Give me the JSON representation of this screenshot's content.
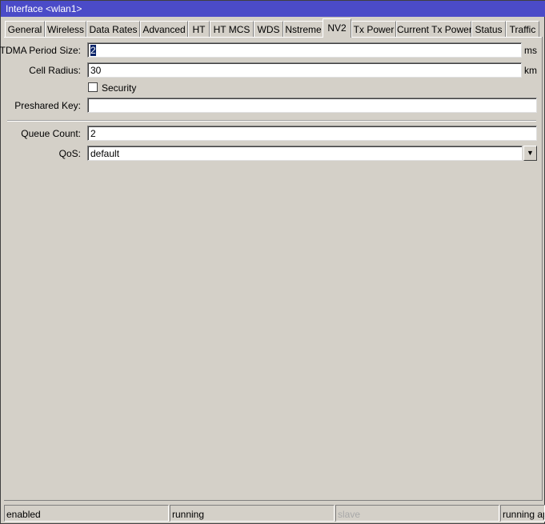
{
  "window": {
    "title": "Interface <wlan1>"
  },
  "tabs": [
    {
      "label": "General"
    },
    {
      "label": "Wireless"
    },
    {
      "label": "Data Rates"
    },
    {
      "label": "Advanced"
    },
    {
      "label": "HT"
    },
    {
      "label": "HT MCS"
    },
    {
      "label": "WDS"
    },
    {
      "label": "Nstreme"
    },
    {
      "label": "NV2",
      "selected": true
    },
    {
      "label": "Tx Power"
    },
    {
      "label": "Current Tx Power"
    },
    {
      "label": "Status"
    },
    {
      "label": "Traffic"
    }
  ],
  "form": {
    "tdma_label": "TDMA Period Size:",
    "tdma_value": "2",
    "tdma_unit": "ms",
    "cell_label": "Cell Radius:",
    "cell_value": "30",
    "cell_unit": "km",
    "security_label": "Security",
    "security_checked": false,
    "psk_label": "Preshared Key:",
    "psk_value": "",
    "queue_label": "Queue Count:",
    "queue_value": "2",
    "qos_label": "QoS:",
    "qos_value": "default"
  },
  "status": {
    "state": "enabled",
    "running": "running",
    "slave": "slave",
    "mode": "running ap"
  },
  "colors": {
    "titlebar": "#4b4bc8",
    "background": "#d4d0c8"
  }
}
